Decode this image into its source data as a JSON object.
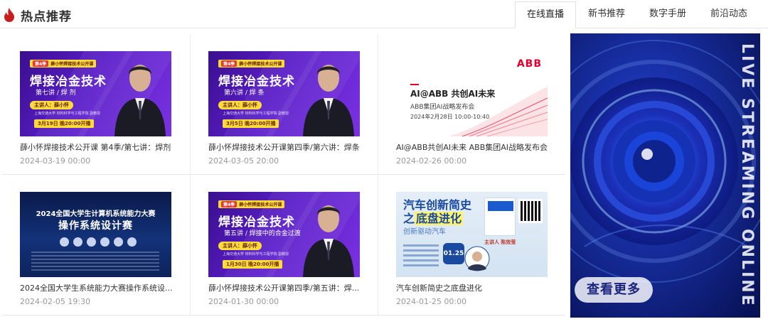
{
  "header": {
    "title": "热点推荐",
    "tabs": [
      {
        "label": "在线直播",
        "active": true
      },
      {
        "label": "新书推荐",
        "active": false
      },
      {
        "label": "数字手册",
        "active": false
      },
      {
        "label": "前沿动态",
        "active": false
      }
    ]
  },
  "cards": [
    {
      "title": "薛小怀焊接技术公开课 第4季/第七讲：焊剂",
      "date": "2024-03-19 00:00",
      "thumb": {
        "tag_num": "第4季",
        "tag_text": "薛小怀焊接技术公开课",
        "headline": "焊接冶金技术",
        "sub": "第七讲 / 焊 剂",
        "lecturer": "主讲人：薛小怀",
        "affiliation": "上海交通大学 材料科学与工程学院 副教授",
        "date_pill": "3月19日 晚20:00开播"
      }
    },
    {
      "title": "薛小怀焊接技术公开课第四季/第六讲：焊条",
      "date": "2024-03-05 20:00",
      "thumb": {
        "tag_num": "第4季",
        "tag_text": "薛小怀焊接技术公开课",
        "headline": "焊接冶金技术",
        "sub": "第六讲 / 焊 条",
        "lecturer": "主讲人：薛小怀",
        "affiliation": "上海交通大学 材料科学与工程学院 副教授",
        "date_pill": "3月5日 晚20:00开播"
      }
    },
    {
      "title": "AI@ABB共创AI未来 ABB集团AI战略发布会",
      "date": "2024-02-26 00:00",
      "thumb": {
        "logo": "ABB",
        "headline": "AI@ABB 共创AI未来",
        "sub": "ABB集团AI战略发布会",
        "when": "2024年2月28日  10:00-10:40"
      }
    },
    {
      "title": "2024全国大学生系统能力大赛操作系统设...",
      "date": "2024-02-05 19:30",
      "thumb": {
        "line1": "2024全国大学生计算机系统能力大赛",
        "line2": "操作系统设计赛"
      }
    },
    {
      "title": "薛小怀焊接技术公开课第四季/第五讲：焊...",
      "date": "2024-01-30 00:00",
      "thumb": {
        "tag_num": "第4季",
        "tag_text": "薛小怀焊接技术公开课",
        "headline": "焊接冶金技术",
        "sub": "第五讲 / 焊接中的合金过渡",
        "lecturer": "主讲人：薛小怀",
        "affiliation": "上海交通大学 材料科学与工程学院 副教授",
        "date_pill": "1月30日 晚20:00开播"
      }
    },
    {
      "title": "汽车创新简史之底盘进化",
      "date": "2024-01-25 00:00",
      "thumb": {
        "line1": "汽车创新简史",
        "line2_pre": "之",
        "line2_hl": "底盘进化",
        "line3": "创新驱动汽车",
        "lecturer": "主讲人 陈效莹",
        "date": "01.25"
      }
    }
  ],
  "promo": {
    "more_label": "查看更多",
    "vertical_text": "LIVE STREAMING ONLINE"
  },
  "colors": {
    "logo": "#c81e1e",
    "promo_bg": "#0a1a7a",
    "weld_bg": "#5b1ec9",
    "accent_yellow": "#ffdb3a"
  }
}
